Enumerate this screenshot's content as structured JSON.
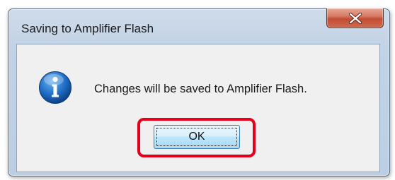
{
  "dialog": {
    "title": "Saving to Amplifier Flash",
    "message": "Changes will be saved to Amplifier Flash.",
    "icon": "info-icon",
    "ok_label": "OK",
    "close_icon": "close-icon"
  },
  "colors": {
    "highlight": "#e3001b",
    "close_button": "#c24d33",
    "icon_blue": "#1a5fb4"
  }
}
